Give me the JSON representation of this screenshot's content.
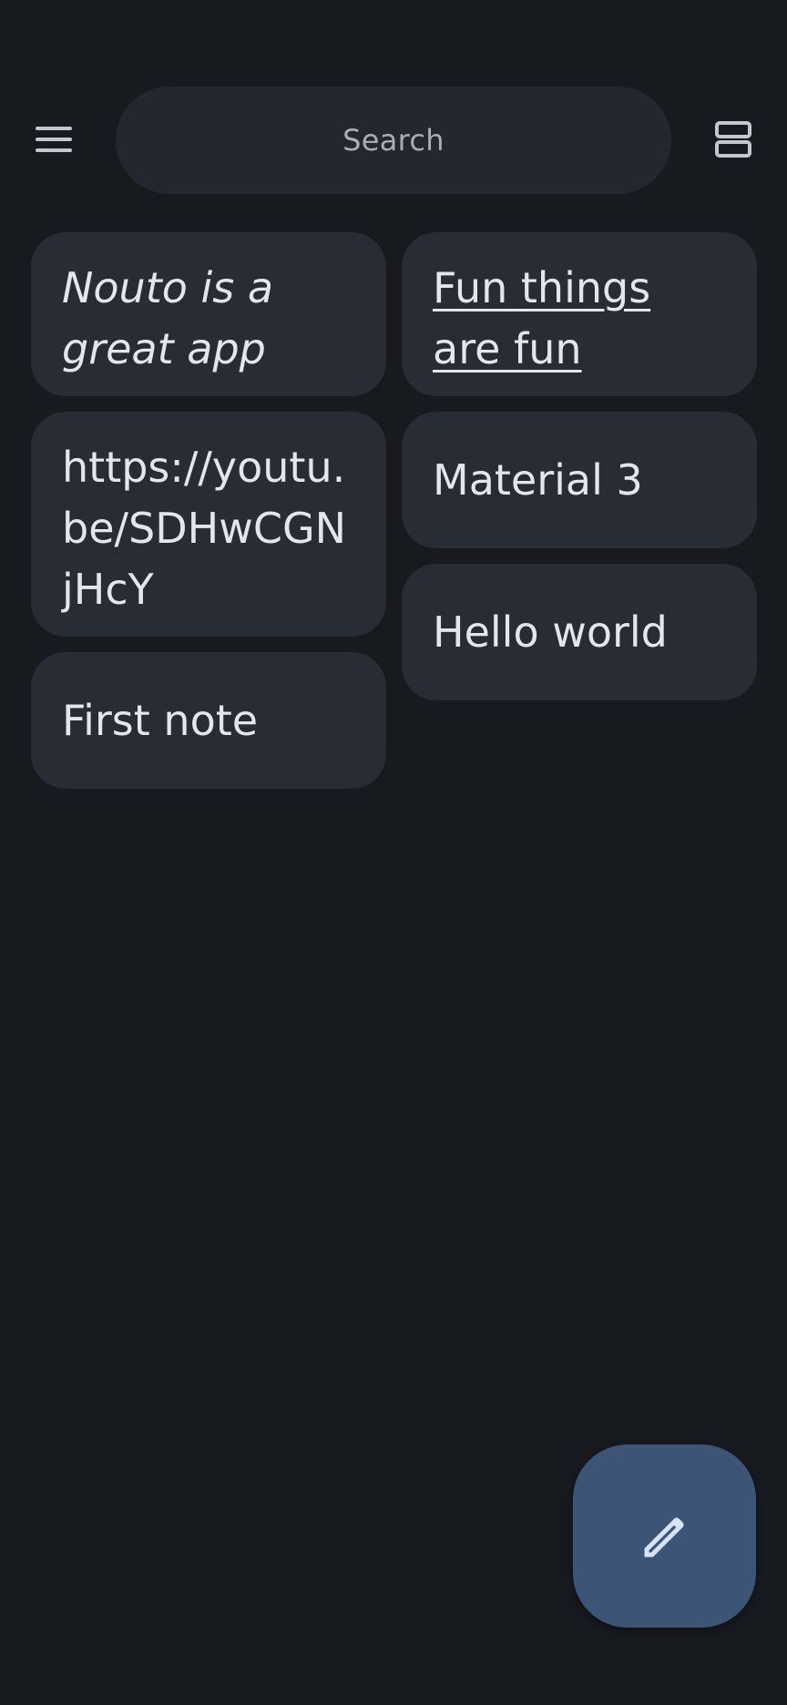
{
  "search": {
    "placeholder": "Search"
  },
  "icons": {
    "menu": "menu-icon",
    "layout": "view-agenda-icon",
    "fab": "edit-pencil-icon"
  },
  "notes": [
    {
      "text": "Nouto is a great app",
      "style": "italic"
    },
    {
      "text": "Fun things are fun",
      "style": "underline"
    },
    {
      "text": "https://youtu.be/SDHwCGNjHcY",
      "style": "plain"
    },
    {
      "text": "Material 3",
      "style": "plain"
    },
    {
      "text": "Hello world",
      "style": "plain"
    },
    {
      "text": "First note",
      "style": "plain"
    }
  ],
  "colors": {
    "background": "#171a1f",
    "card": "#282c35",
    "search": "#23272f",
    "fab": "#3c5475",
    "fab_icon": "#d6e3ff"
  }
}
